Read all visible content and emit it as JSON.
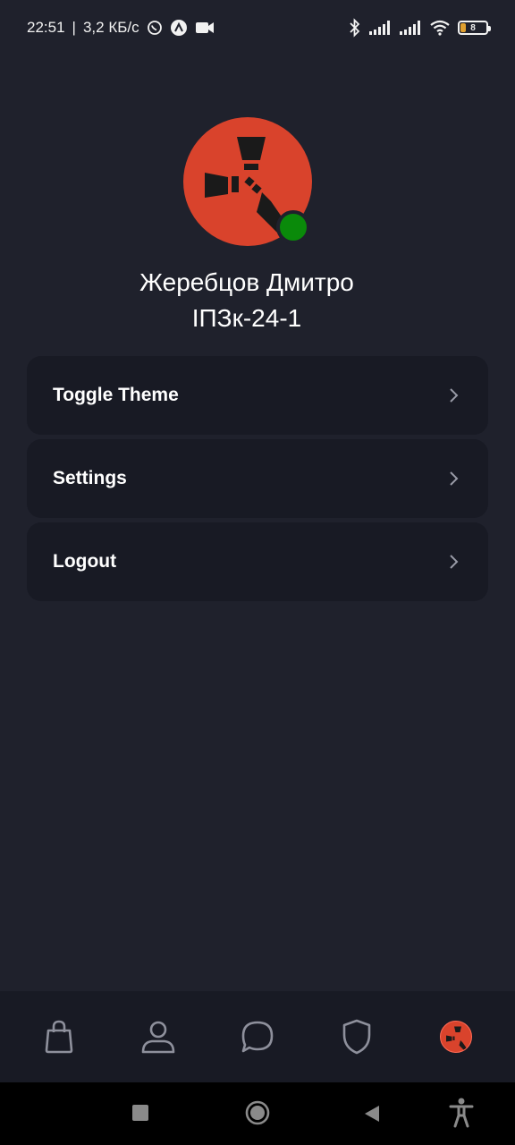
{
  "status_bar": {
    "time": "22:51",
    "speed": "3,2 КБ/с",
    "battery_level": "8",
    "icons_left": [
      "whatsapp-icon",
      "app-icon",
      "video-icon"
    ],
    "icons_right": [
      "bluetooth-icon",
      "signal-icon",
      "signal-icon",
      "wifi-icon",
      "battery-icon"
    ]
  },
  "profile": {
    "name": "Жеребцов Дмитро",
    "group": "ІПЗк-24-1",
    "avatar_color": "#d9432c",
    "online_color": "#0a8a0a"
  },
  "menu": {
    "items": [
      {
        "label": "Toggle Theme",
        "icon": "chevron-right-icon"
      },
      {
        "label": "Settings",
        "icon": "chevron-right-icon"
      },
      {
        "label": "Logout",
        "icon": "chevron-right-icon"
      }
    ]
  },
  "bottom_nav": {
    "items": [
      "shopping-bag-icon",
      "user-icon",
      "chat-icon",
      "shield-icon",
      "profile-avatar-icon"
    ],
    "active": "profile-avatar-icon"
  },
  "system_nav": [
    "recents-icon",
    "home-icon",
    "back-icon",
    "accessibility-icon"
  ],
  "colors": {
    "background": "#1f212c",
    "card": "#181a24",
    "accent": "#d9432c",
    "text": "#ffffff"
  }
}
